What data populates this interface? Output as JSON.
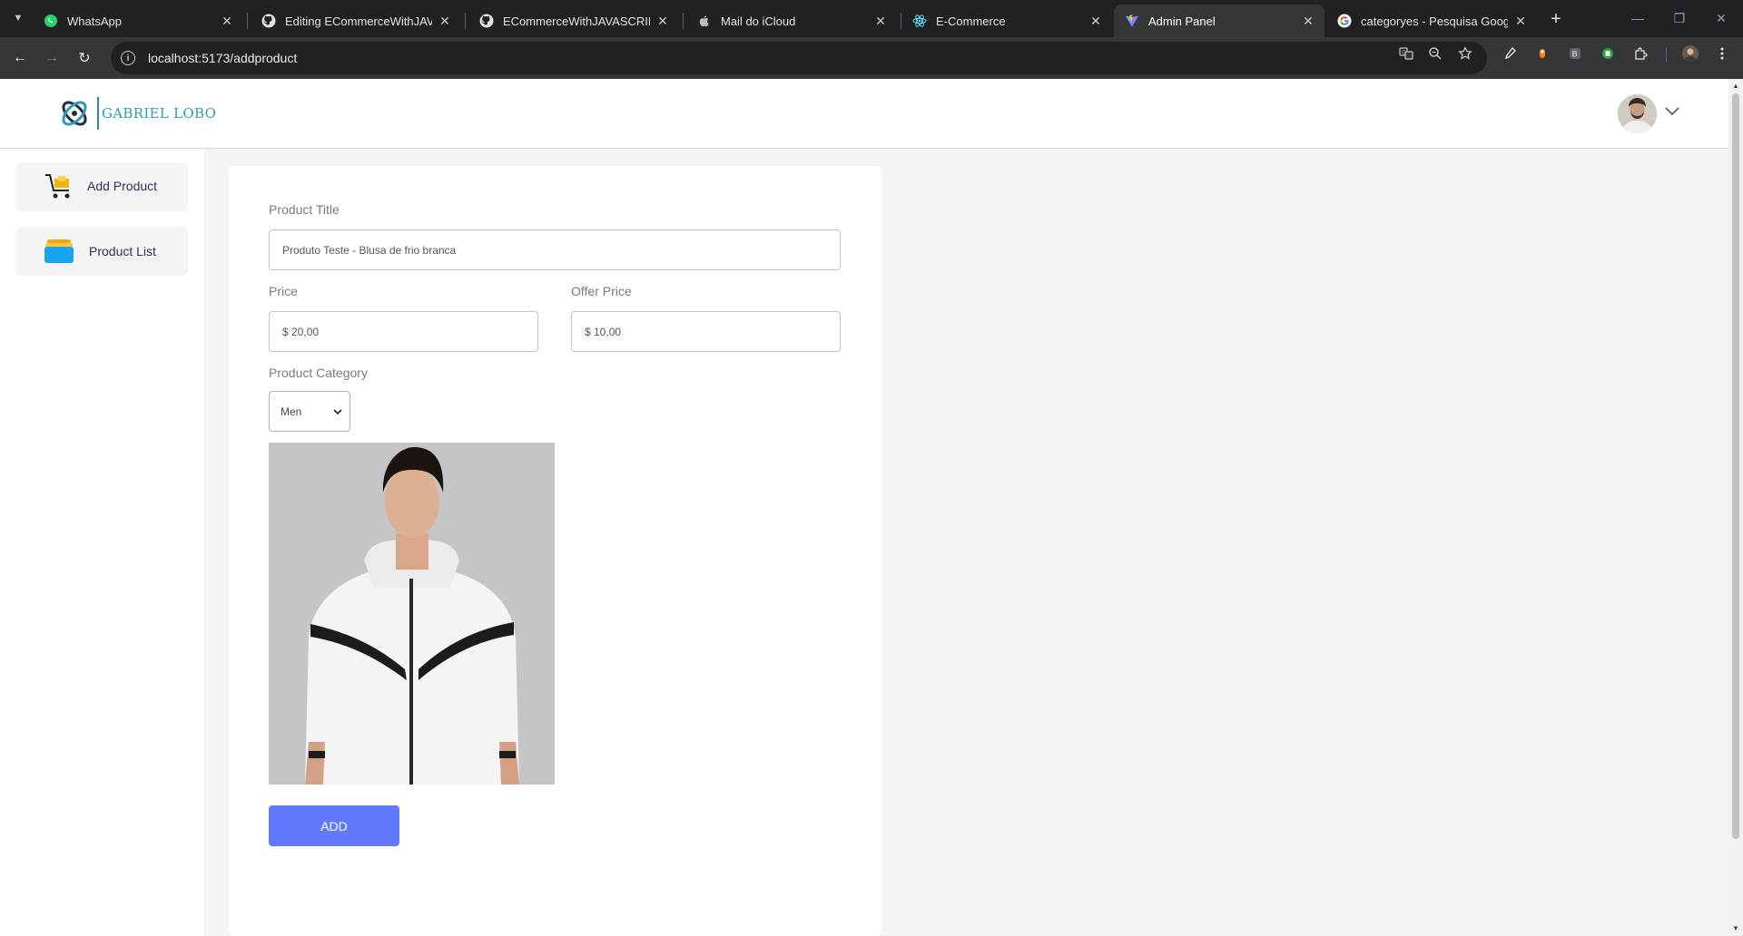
{
  "browser": {
    "tabs": [
      {
        "title": "WhatsApp",
        "icon": "whatsapp-icon",
        "active": false
      },
      {
        "title": "Editing ECommerceWithJAVASCRIPT",
        "icon": "github-icon",
        "active": false
      },
      {
        "title": "ECommerceWithJAVASCRIPT/fr",
        "icon": "github-icon",
        "active": false
      },
      {
        "title": "Mail do iCloud",
        "icon": "apple-icon",
        "active": false
      },
      {
        "title": "E-Commerce",
        "icon": "react-icon",
        "active": false
      },
      {
        "title": "Admin Panel",
        "icon": "vite-icon",
        "active": true
      },
      {
        "title": "categoryes - Pesquisa Google",
        "icon": "google-icon",
        "active": false
      }
    ],
    "url": "localhost:5173/addproduct"
  },
  "navbar": {
    "brand": "GABRIEL LOBO"
  },
  "sidebar": {
    "items": [
      {
        "label": "Add Product",
        "icon": "cart-icon"
      },
      {
        "label": "Product List",
        "icon": "product-list-icon"
      }
    ]
  },
  "form": {
    "title_label": "Product Title",
    "title_value": "Produto Teste - Blusa de frio branca",
    "price_label": "Price",
    "price_value": "$ 20,00",
    "offer_label": "Offer Price",
    "offer_value": "$ 10,00",
    "category_label": "Product Category",
    "category_selected": "Men",
    "add_button": "ADD"
  },
  "colors": {
    "accent": "#6079ff",
    "brand": "#2e9bb2",
    "sidebar_text": "#3b2b5a"
  }
}
